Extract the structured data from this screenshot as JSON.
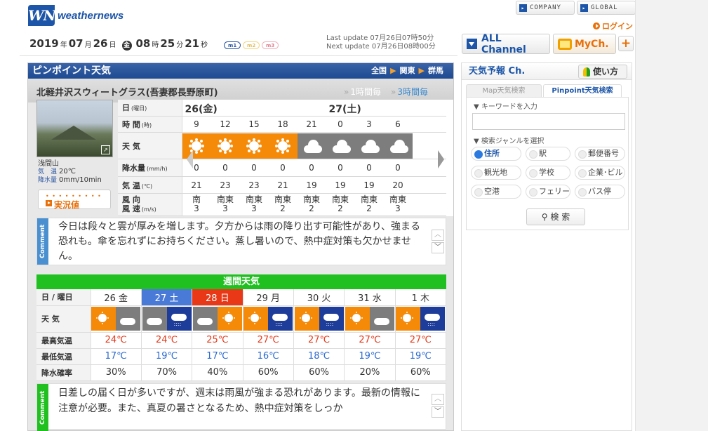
{
  "header": {
    "logo_mark": "WN",
    "logo_text": "weathernews",
    "company": "COMPANY",
    "global": "GLOBAL",
    "login": "ログイン",
    "all_channel": "ALL Channel",
    "mych": "MyCh.",
    "plus": "+"
  },
  "datebar": {
    "year": "2019",
    "year_unit": "年",
    "month": "07",
    "month_unit": "月",
    "day": "26",
    "day_unit": "日",
    "weekday": "金",
    "hour": "08",
    "hour_unit": "時",
    "minute": "25",
    "minute_unit": "分",
    "second": "21",
    "second_unit": "秒",
    "pills": [
      "m1",
      "m2",
      "m3"
    ],
    "last_update": "Last update  07月26日07時50分",
    "next_update": "Next update  07月26日08時00分"
  },
  "pinpoint": {
    "title": "ピンポイント天気",
    "crumbs": [
      "全国",
      "関東",
      "群馬"
    ],
    "location": "北軽井沢スウィートグラス(吾妻郡長野原町)",
    "tab_1h": "1時間毎",
    "tab_3h": "3時間毎",
    "camera": {
      "name": "浅間山",
      "temp_label": "気　温",
      "temp": "20℃",
      "rain_label": "降水量",
      "rain": "0mm/10min",
      "live": "実況値"
    },
    "row_labels": {
      "day": "日",
      "day_sub": "(曜日)",
      "time": "時 間",
      "time_sub": "(時)",
      "weather": "天 気",
      "precip": "降水量",
      "precip_sub": "(mm/h)",
      "temp": "気 温",
      "temp_sub": "(℃)",
      "wind_dir": "風 向",
      "wind_speed": "風 速",
      "wind_speed_sub": "(m/s)"
    },
    "day1": "26(金)",
    "day2": "27(土)",
    "hours": [
      "9",
      "12",
      "15",
      "18",
      "21",
      "0",
      "3",
      "6"
    ],
    "weather": [
      "sun",
      "sun",
      "sun",
      "sun",
      "cloud",
      "cloud",
      "cloud",
      "cloud"
    ],
    "precip": [
      "0",
      "0",
      "0",
      "0",
      "0",
      "0",
      "0",
      "0"
    ],
    "temps": [
      "21",
      "23",
      "23",
      "21",
      "19",
      "19",
      "19",
      "20"
    ],
    "wind_dir": [
      "南",
      "南東",
      "南東",
      "南東",
      "南東",
      "南東",
      "南東",
      "南東"
    ],
    "wind_speed": [
      "3",
      "3",
      "3",
      "2",
      "2",
      "2",
      "2",
      "3"
    ],
    "comment_tag": "Comment",
    "comment": "今日は段々と雲が厚みを増します。夕方からは雨の降り出す可能性があり、強まる恐れも。傘を忘れずにお持ちください。蒸し暑いので、熱中症対策も欠かせません。"
  },
  "weekly": {
    "title": "週間天気",
    "labels": {
      "day": "日 / 曜日",
      "weather": "天 気",
      "max": "最高気温",
      "min": "最低気温",
      "pop": "降水確率"
    },
    "days": [
      "26 金",
      "27 土",
      "28 日",
      "29 月",
      "30 火",
      "31 水",
      "1 木"
    ],
    "icons": [
      [
        "sun",
        "cloud"
      ],
      [
        "cloud",
        "rain"
      ],
      [
        "cloud",
        "sun"
      ],
      [
        "sun",
        "rain"
      ],
      [
        "sun",
        "rain"
      ],
      [
        "sun",
        "cloud"
      ],
      [
        "sun",
        "rain"
      ]
    ],
    "max": [
      "24℃",
      "24℃",
      "25℃",
      "27℃",
      "27℃",
      "27℃",
      "27℃"
    ],
    "min": [
      "17℃",
      "19℃",
      "17℃",
      "16℃",
      "18℃",
      "19℃",
      "19℃"
    ],
    "pop": [
      "30%",
      "70%",
      "40%",
      "60%",
      "60%",
      "20%",
      "60%"
    ],
    "comment_tag": "Comment",
    "comment": "日差しの届く日が多いですが、週末は雨風が強まる恐れがあります。最新の情報に注意が必要。また、真夏の暑さとなるため、熱中症対策をしっか"
  },
  "sidebar": {
    "title": "天気予報 Ch.",
    "howto": "使い方",
    "tab_map": "Map天気検索",
    "tab_pinpoint": "Pinpoint天気検索",
    "keyword_label": "▼ キーワードを入力",
    "genre_label": "▼ 検索ジャンルを選択",
    "genres": [
      "住所",
      "駅",
      "郵便番号",
      "観光地",
      "学校",
      "企業･ビル",
      "空港",
      "フェリー",
      "バス停"
    ],
    "search": "検 索"
  }
}
